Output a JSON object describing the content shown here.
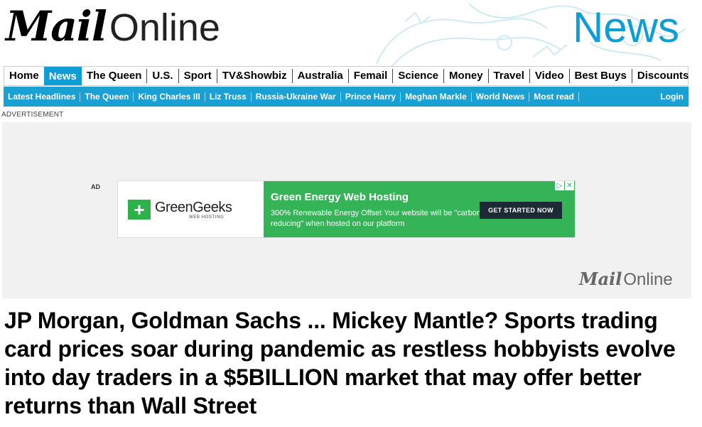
{
  "masthead": {
    "logo_mail": "Mail",
    "logo_online": "Online",
    "section_title": "News"
  },
  "nav_primary": [
    {
      "label": "Home",
      "active": false
    },
    {
      "label": "News",
      "active": true
    },
    {
      "label": "The Queen",
      "active": false
    },
    {
      "label": "U.S.",
      "active": false
    },
    {
      "label": "Sport",
      "active": false
    },
    {
      "label": "TV&Showbiz",
      "active": false
    },
    {
      "label": "Australia",
      "active": false
    },
    {
      "label": "Femail",
      "active": false
    },
    {
      "label": "Science",
      "active": false
    },
    {
      "label": "Money",
      "active": false
    },
    {
      "label": "Travel",
      "active": false
    },
    {
      "label": "Video",
      "active": false
    },
    {
      "label": "Best Buys",
      "active": false
    },
    {
      "label": "Discounts",
      "active": false
    }
  ],
  "nav_secondary": {
    "items": [
      "Latest Headlines",
      "The Queen",
      "King Charles III",
      "Liz Truss",
      "Russia-Ukraine War",
      "Prince Harry",
      "Meghan Markle",
      "World News",
      "Most read"
    ],
    "login": "Login"
  },
  "advertisement_label": "ADVERTISEMENT",
  "ad": {
    "tag": "AD",
    "brand_name": "GreenGeeks",
    "brand_sub": "WEB HOSTING",
    "headline": "Green Energy Web Hosting",
    "body": "300% Renewable Energy Offset Your website will be \"carbon-reducing\" when hosted on our platform",
    "cta": "GET STARTED NOW",
    "footer_logo_mail": "Mail",
    "footer_logo_online": "Online"
  },
  "article": {
    "headline": "JP Morgan, Goldman Sachs ... Mickey Mantle? Sports trading card prices soar during pandemic as restless hobbyists evolve into day traders in a $5BILLION market that may offer better returns than Wall Street"
  },
  "colors": {
    "brand_blue": "#0d9ed6",
    "nav_blue": "#1aa1d3",
    "ad_green": "#34b456"
  }
}
